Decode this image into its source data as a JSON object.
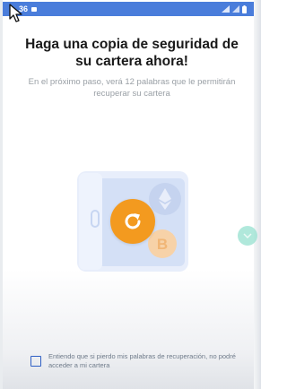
{
  "status_bar": {
    "time": "36",
    "right_icons": [
      "signal-icon",
      "wifi-icon",
      "battery-icon"
    ],
    "color": "#4a7ddb"
  },
  "page": {
    "title": "Haga una copia de seguridad de su cartera ahora!",
    "subtitle": "En el próximo paso, verá 12 palabras que le permitirán recuperar su cartera"
  },
  "illustration": {
    "icons": [
      "safe-icon",
      "ethereum-icon",
      "bitcoin-icon",
      "refresh-icon"
    ],
    "accent_color": "#f39a1f"
  },
  "acknowledgement": {
    "checked": false,
    "text": "Entiendo que si pierdo mis palabras de recuperación, no podré acceder a mi cartera"
  }
}
